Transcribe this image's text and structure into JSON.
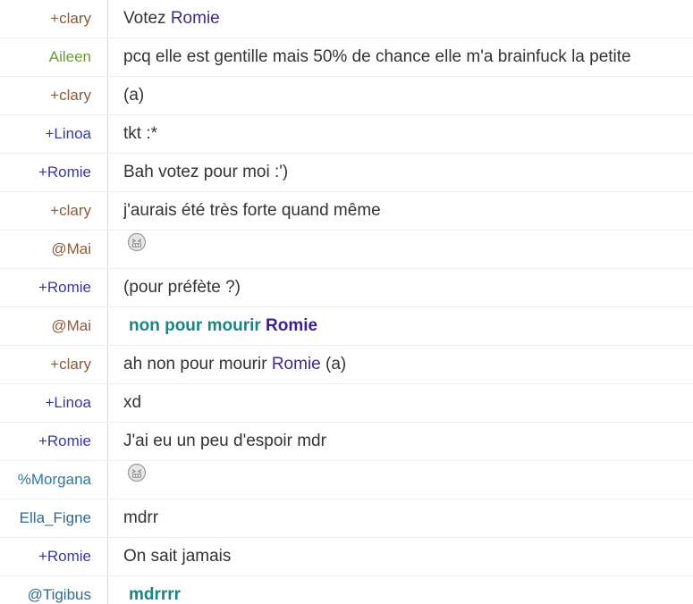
{
  "colors": {
    "clary": "#8a5a3c",
    "aileen": "#6e9a3a",
    "linoa": "#3a3a9a",
    "romie": "#3a3a9a",
    "mai": "#8a5a3c",
    "morgana": "#2f7a9a",
    "ella": "#2f6a8a",
    "tigibus": "#2f6a8a",
    "highlight": "#3d2a8a",
    "bold_teal": "#1a8585"
  },
  "messages": [
    {
      "nick": "+clary",
      "color": "clary",
      "parts": [
        "Votez ",
        "Romie"
      ],
      "type": "mention"
    },
    {
      "nick": "Aileen",
      "color": "aileen",
      "text": "pcq elle est gentille mais 50% de chance elle m'a brainfuck la petite",
      "type": "plain"
    },
    {
      "nick": "+clary",
      "color": "clary",
      "text": "(a)",
      "type": "plain"
    },
    {
      "nick": "+Linoa",
      "color": "linoa",
      "text": "tkt :*",
      "type": "plain"
    },
    {
      "nick": "+Romie",
      "color": "romie",
      "text": "Bah votez pour moi :')",
      "type": "plain"
    },
    {
      "nick": "+clary",
      "color": "clary",
      "text": "j'aurais été très forte quand même",
      "type": "plain"
    },
    {
      "nick": "@Mai",
      "color": "mai",
      "icon": "grimace-emoji-icon",
      "type": "emoji"
    },
    {
      "nick": "+Romie",
      "color": "romie",
      "text": "(pour préfète ?)",
      "type": "plain"
    },
    {
      "nick": "@Mai",
      "color": "mai",
      "parts": [
        "non pour mourir ",
        "Romie"
      ],
      "type": "bold"
    },
    {
      "nick": "+clary",
      "color": "clary",
      "parts": [
        "ah non pour mourir ",
        "Romie",
        " (a)"
      ],
      "type": "mention3"
    },
    {
      "nick": "+Linoa",
      "color": "linoa",
      "text": "xd",
      "type": "plain"
    },
    {
      "nick": "+Romie",
      "color": "romie",
      "text": "J'ai eu un peu d'espoir mdr",
      "type": "plain"
    },
    {
      "nick": "%Morgana",
      "color": "morgana",
      "icon": "grimace-emoji-icon",
      "type": "emoji"
    },
    {
      "nick": "Ella_Figne",
      "color": "ella",
      "text": "mdrr",
      "type": "plain"
    },
    {
      "nick": "+Romie",
      "color": "romie",
      "text": "On sait jamais",
      "type": "plain"
    },
    {
      "nick": "@Tigibus",
      "color": "tigibus",
      "parts": [
        "mdrrrr"
      ],
      "type": "bold"
    }
  ]
}
